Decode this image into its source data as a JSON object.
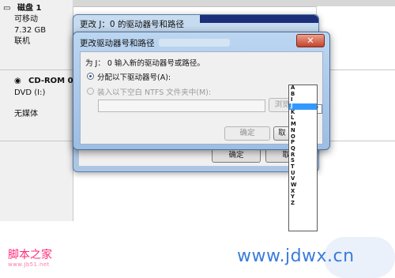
{
  "disk_manager": {
    "disk1_label": "磁盘 1",
    "disk1_type": "可移动",
    "disk1_size": "7.32 GB",
    "disk1_status": "联机",
    "cdrom_label": "CD-ROM 0",
    "cdrom_drive": "DVD (I:)",
    "cdrom_media": "无媒体"
  },
  "outer_dialog": {
    "title": "更改 J：0 的驱动器号和路径",
    "ok_label": "确定",
    "cancel_label": "取消"
  },
  "change_dialog": {
    "title": "更改驱动器号和路径",
    "close_symbol": "✕",
    "prompt": "为 J： 0 输入新的驱动器号或路径。",
    "option_assign_label": "分配以下驱动器号(A):",
    "option_mount_label": "装入以下空白 NTFS 文件夹中(M):",
    "path_value": "",
    "browse_label": "浏览(",
    "ok_label": "确定",
    "cancel_label": "取",
    "selected_drive": "J"
  },
  "drive_letters": [
    "A",
    "B",
    "I",
    "J",
    "K",
    "L",
    "M",
    "N",
    "O",
    "P",
    "Q",
    "R",
    "S",
    "T",
    "U",
    "V",
    "W",
    "X",
    "Y",
    "Z"
  ],
  "watermark": {
    "left_text": "脚本之家",
    "left_sub": "www.Jb51.net",
    "right_text": "www.jdwx.cn"
  },
  "colors": {
    "dialog_frame": "#a9c6e6",
    "selected_item": "#3399ff",
    "close_button": "#c4432b",
    "watermark_pink": "#ff2a7a",
    "watermark_blue": "#3a7bdc"
  }
}
